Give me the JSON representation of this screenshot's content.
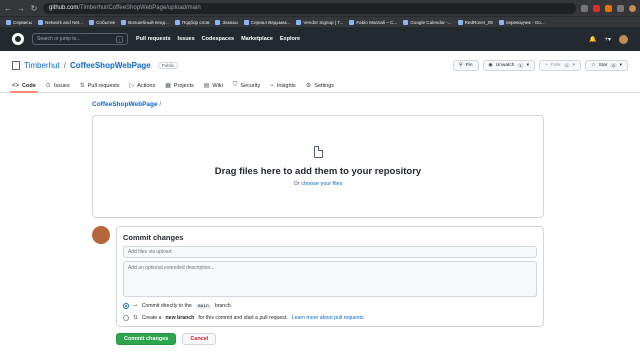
{
  "browser": {
    "url_host": "github.com",
    "url_path": "/Timberhut/CoffeeShopWebPage/upload/main",
    "bookmarks": [
      "Сервисы",
      "Network and Net...",
      "Событие",
      "Волшебный пенд...",
      "Подбор слов",
      "Заказы",
      "Сериал Ведьмак...",
      "Vendor Signup | T...",
      "Fabio Marziali – C...",
      "Google Calendar -...",
      "RedRover_06",
      "переводчик - Go..."
    ]
  },
  "header": {
    "search_placeholder": "Search or jump to...",
    "search_shortcut": "/",
    "nav": [
      "Pull requests",
      "Issues",
      "Codespaces",
      "Marketplace",
      "Explore"
    ],
    "bell": "🔔",
    "plus": "+▾"
  },
  "repo": {
    "owner": "Timberhut",
    "name": "CoffeeShopWebPage",
    "visibility": "Public",
    "pin": "Pin",
    "unwatch": "Unwatch",
    "unwatch_count": "1",
    "fork": "Fork",
    "fork_count": "0",
    "star": "Star",
    "star_count": "0"
  },
  "tabs": [
    {
      "label": "Code",
      "icon": "<>"
    },
    {
      "label": "Issues",
      "icon": "⊙"
    },
    {
      "label": "Pull requests",
      "icon": "⇅"
    },
    {
      "label": "Actions",
      "icon": "▷"
    },
    {
      "label": "Projects",
      "icon": "▦"
    },
    {
      "label": "Wiki",
      "icon": "▤"
    },
    {
      "label": "Security",
      "icon": "⛉"
    },
    {
      "label": "Insights",
      "icon": "⌁"
    },
    {
      "label": "Settings",
      "icon": "⚙"
    }
  ],
  "breadcrumb": {
    "repo": "CoffeeShopWebPage",
    "sep": "/"
  },
  "upload": {
    "title": "Drag files here to add them to your repository",
    "or": "Or",
    "choose": "choose your files"
  },
  "commit": {
    "title": "Commit changes",
    "message_placeholder": "Add files via upload",
    "description_placeholder": "Add an optional extended description...",
    "option1_pre": "Commit directly to the",
    "option1_branch": "main",
    "option1_post": "branch.",
    "option2_pre": "Create a",
    "option2_bold": "new branch",
    "option2_post": "for this commit and start a pull request.",
    "option2_link": "Learn more about pull requests.",
    "submit": "Commit changes",
    "cancel": "Cancel"
  }
}
